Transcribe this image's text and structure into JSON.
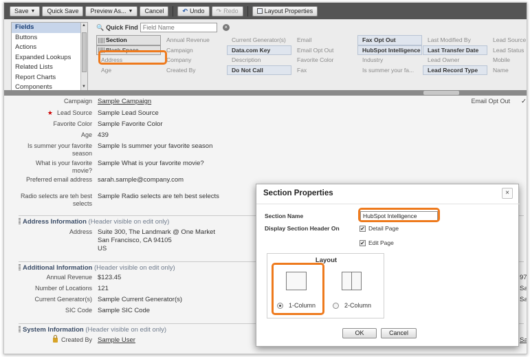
{
  "toolbar": {
    "save": "Save",
    "quick_save": "Quick Save",
    "preview_as": "Preview As...",
    "cancel": "Cancel",
    "undo": "Undo",
    "redo": "Redo",
    "layout_properties": "Layout Properties"
  },
  "palette": {
    "categories": [
      "Fields",
      "Buttons",
      "Actions",
      "Expanded Lookups",
      "Related Lists",
      "Report Charts",
      "Components"
    ],
    "active_category": "Fields",
    "quick_find_label": "Quick Find",
    "quick_find_placeholder": "Field Name",
    "fields": [
      [
        "Section",
        "Annual Revenue",
        "Current Generator(s)",
        "Email",
        "Fax Opt Out",
        "Last Modified By",
        "Lead Source"
      ],
      [
        "Blank Space",
        "Campaign",
        "Data.com Key",
        "Email Opt Out",
        "HubSpot Intelligence",
        "Last Transfer Date",
        "Lead Status"
      ],
      [
        "Address",
        "Company",
        "Description",
        "Favorite Color",
        "Industry",
        "Lead Owner",
        "Mobile"
      ],
      [
        "Age",
        "Created By",
        "Do Not Call",
        "Fax",
        "Is summer your fa...",
        "Lead Record Type",
        "Name"
      ]
    ]
  },
  "layout": {
    "fields": [
      {
        "label": "Campaign",
        "value": "Sample Campaign",
        "link": true
      },
      {
        "label": "Lead Source",
        "value": "Sample Lead Source",
        "required": true
      },
      {
        "label": "Favorite Color",
        "value": "Sample Favorite Color"
      },
      {
        "label": "Age",
        "value": "439"
      },
      {
        "label": "Is summer your favorite season",
        "value": "Sample Is summer your favorite season"
      },
      {
        "label": "What is your favorite movie?",
        "value": "Sample What is your favorite movie?"
      },
      {
        "label": "Preferred email address",
        "value": "sarah.sample@company.com"
      },
      {
        "label": "Radio selects are teh best selects",
        "value": "Sample Radio selects are teh best selects"
      }
    ],
    "right_field_label": "Email Opt Out",
    "right_check": "✓",
    "address_section": {
      "title": "Address Information",
      "subtitle": "(Header visible on edit only)",
      "label": "Address",
      "lines": [
        "Suite 300, The Landmark @ One Market",
        "San Francisco, CA 94105",
        "US"
      ]
    },
    "additional_section": {
      "title": "Additional Information",
      "subtitle": "(Header visible on edit only)",
      "fields": [
        {
          "label": "Annual Revenue",
          "value": "$123.45"
        },
        {
          "label": "Number of Locations",
          "value": "121"
        },
        {
          "label": "Current Generator(s)",
          "value": "Sample Current Generator(s)"
        },
        {
          "label": "SIC Code",
          "value": "Sample SIC Code"
        }
      ],
      "right_values": [
        "97",
        "Sa",
        "Sa"
      ]
    },
    "system_section": {
      "title": "System Information",
      "subtitle": "(Header visible on edit only)",
      "label": "Created By",
      "value": "Sample User",
      "right_value": "Sa"
    }
  },
  "modal": {
    "title": "Section Properties",
    "close": "×",
    "section_name_label": "Section Name",
    "section_name_value": "HubSpot Intelligence",
    "display_header_label": "Display Section Header On",
    "detail_page": "Detail Page",
    "edit_page": "Edit Page",
    "layout_title": "Layout",
    "one_column": "1-Column",
    "two_column": "2-Column",
    "ok": "OK",
    "cancel": "Cancel"
  },
  "colors": {
    "highlight": "#ee7a1d",
    "toolbar": "#555555",
    "section_header": "#3a4c67"
  }
}
